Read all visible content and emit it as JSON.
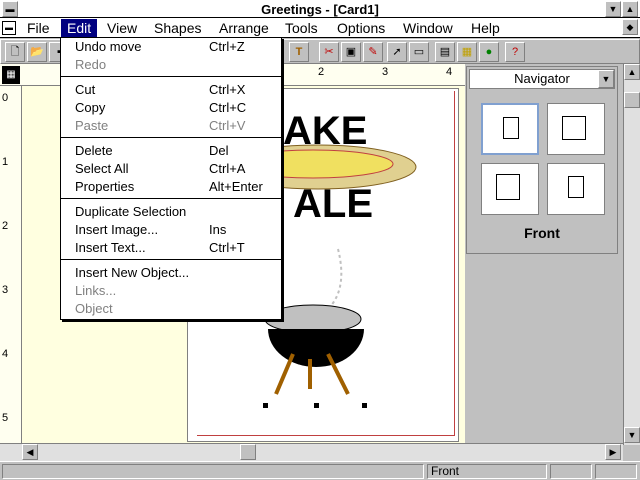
{
  "window": {
    "title": "Greetings - [Card1]"
  },
  "menubar": {
    "items": [
      {
        "label": "File"
      },
      {
        "label": "Edit"
      },
      {
        "label": "View"
      },
      {
        "label": "Shapes"
      },
      {
        "label": "Arrange"
      },
      {
        "label": "Tools"
      },
      {
        "label": "Options"
      },
      {
        "label": "Window"
      },
      {
        "label": "Help"
      }
    ]
  },
  "edit_menu": {
    "items": [
      {
        "label": "Undo move",
        "shortcut": "Ctrl+Z",
        "enabled": true
      },
      {
        "label": "Redo",
        "shortcut": "",
        "enabled": false
      },
      {
        "label": "Cut",
        "shortcut": "Ctrl+X",
        "enabled": true
      },
      {
        "label": "Copy",
        "shortcut": "Ctrl+C",
        "enabled": true
      },
      {
        "label": "Paste",
        "shortcut": "Ctrl+V",
        "enabled": false
      },
      {
        "label": "Delete",
        "shortcut": "Del",
        "enabled": true
      },
      {
        "label": "Select All",
        "shortcut": "Ctrl+A",
        "enabled": true
      },
      {
        "label": "Properties",
        "shortcut": "Alt+Enter",
        "enabled": true
      },
      {
        "label": "Duplicate Selection",
        "shortcut": "",
        "enabled": true
      },
      {
        "label": "Insert Image...",
        "shortcut": "Ins",
        "enabled": true
      },
      {
        "label": "Insert Text...",
        "shortcut": "Ctrl+T",
        "enabled": true
      },
      {
        "label": "Insert New Object...",
        "shortcut": "",
        "enabled": true
      },
      {
        "label": "Links...",
        "shortcut": "",
        "enabled": false
      },
      {
        "label": "Object",
        "shortcut": "",
        "enabled": false
      }
    ]
  },
  "ruler": {
    "top_numbers": [
      "2",
      "3",
      "4"
    ],
    "left_numbers": [
      "0",
      "1",
      "2",
      "3",
      "4",
      "5"
    ]
  },
  "card": {
    "line1": "AKE",
    "line2": "ALE"
  },
  "navigator": {
    "title": "Navigator",
    "selected_label": "Front"
  },
  "statusbar": {
    "view": "Front"
  },
  "colors": {
    "menu_highlight": "#000080",
    "canvas": "#ffffe0",
    "margin_line": "#c04040"
  }
}
